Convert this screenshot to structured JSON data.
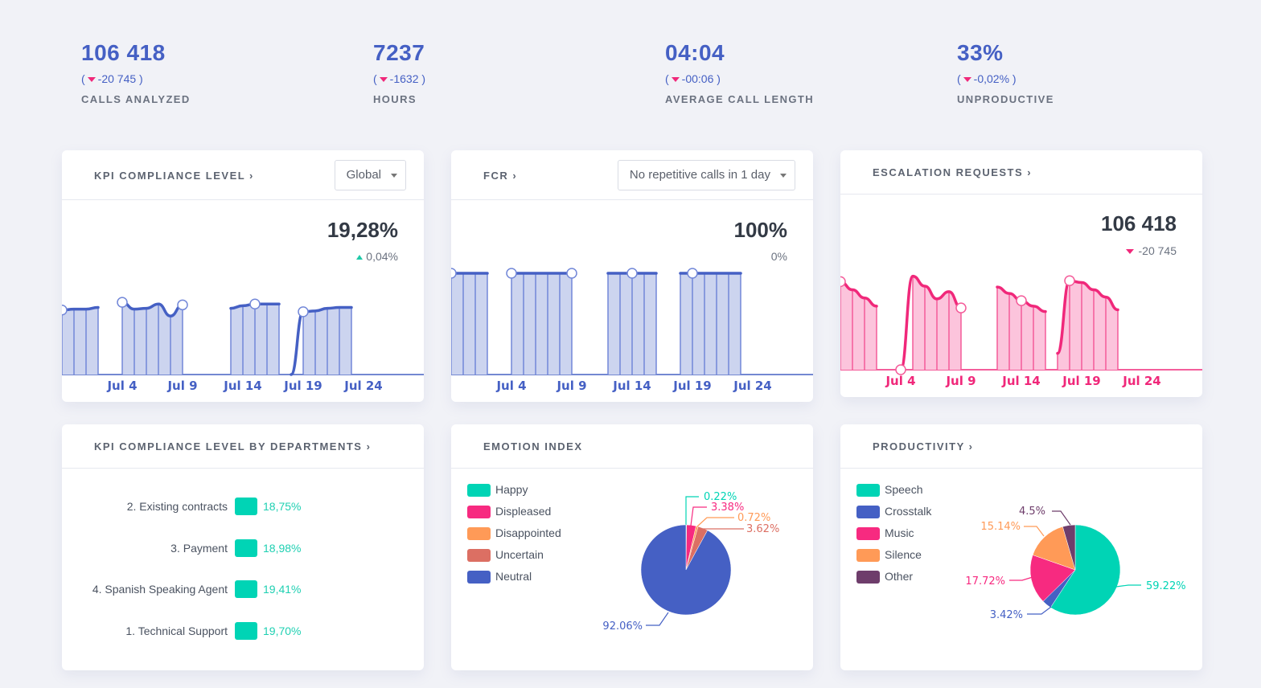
{
  "kpis": [
    {
      "value": "106 418",
      "delta_open": "(",
      "delta": "-20 745",
      "delta_close": ")",
      "trend": "down",
      "label": "CALLS ANALYZED"
    },
    {
      "value": "7237",
      "delta_open": "(",
      "delta": "-1632",
      "delta_close": ")",
      "trend": "down",
      "label": "HOURS"
    },
    {
      "value": "04:04",
      "delta_open": "(",
      "delta": "-00:06",
      "delta_close": ")",
      "trend": "down",
      "label": "AVERAGE CALL LENGTH"
    },
    {
      "value": "33%",
      "delta_open": "(",
      "delta": "-0,02%",
      "delta_close": ")",
      "trend": "down",
      "label": "UNPRODUCTIVE"
    }
  ],
  "cards": {
    "kpi_compliance": {
      "title": "KPI COMPLIANCE LEVEL ›",
      "select": "Global",
      "value": "19,28%",
      "delta": "0,04%",
      "trend": "up"
    },
    "fcr": {
      "title": "FCR ›",
      "select": "No repetitive calls in 1 day",
      "value": "100%",
      "delta": "0%",
      "trend": "none"
    },
    "escalation": {
      "title": "ESCALATION REQUESTS ›",
      "value": "106 418",
      "delta": "-20 745",
      "trend": "down"
    },
    "departments": {
      "title": "KPI COMPLIANCE LEVEL BY DEPARTMENTS ›"
    },
    "emotion": {
      "title": "EMOTION INDEX"
    },
    "productivity": {
      "title": "PRODUCTIVITY ›"
    }
  },
  "colors": {
    "accent_blue": "#4560c4",
    "pink": "#f0287a",
    "teal": "#00d4b5",
    "orange": "#ff9a57",
    "uncertain": "#dc6f63",
    "other": "#6e3d6b"
  },
  "chart_data": [
    {
      "id": "kpi_compliance",
      "type": "area",
      "title": "KPI COMPLIANCE LEVEL",
      "x_ticks": [
        "Jul 4",
        "Jul 9",
        "Jul 14",
        "Jul 19",
        "Jul 24"
      ],
      "x_range": [
        "Jun 29",
        "Jul 29"
      ],
      "ylim": [
        0,
        100
      ],
      "segments": [
        {
          "start_day": 0,
          "values": [
            75,
            76,
            76,
            78
          ],
          "markers": [
            0
          ]
        },
        {
          "start_day": 5,
          "values": [
            84,
            76,
            77,
            82,
            68,
            81
          ],
          "markers": [
            0,
            5
          ]
        },
        {
          "start_day": 14,
          "values": [
            77,
            80,
            82,
            82,
            82
          ],
          "markers": [
            2
          ]
        },
        {
          "start_day": 19,
          "values": [
            0,
            73,
            74,
            77,
            78,
            78
          ],
          "markers": [
            1
          ]
        }
      ]
    },
    {
      "id": "fcr",
      "type": "area",
      "title": "FCR",
      "x_ticks": [
        "Jul 4",
        "Jul 9",
        "Jul 14",
        "Jul 19",
        "Jul 24"
      ],
      "x_range": [
        "Jun 29",
        "Jul 29"
      ],
      "ylim": [
        0,
        100
      ],
      "segments": [
        {
          "start_day": 0,
          "values": [
            100,
            100,
            100,
            100
          ],
          "markers": [
            0
          ]
        },
        {
          "start_day": 5,
          "values": [
            100,
            100,
            100,
            100,
            100,
            100
          ],
          "markers": [
            0,
            5
          ]
        },
        {
          "start_day": 13,
          "values": [
            100,
            100,
            100,
            100,
            100
          ],
          "markers": [
            2
          ]
        },
        {
          "start_day": 19,
          "values": [
            100,
            100,
            100,
            100,
            100,
            100
          ],
          "markers": [
            1
          ]
        }
      ]
    },
    {
      "id": "escalation",
      "type": "area",
      "title": "ESCALATION REQUESTS",
      "x_ticks": [
        "Jul 4",
        "Jul 9",
        "Jul 14",
        "Jul 19",
        "Jul 24"
      ],
      "x_range": [
        "Jun 29",
        "Jul 29"
      ],
      "ylim": [
        0,
        100
      ],
      "segments": [
        {
          "start_day": 0,
          "values": [
            97,
            88,
            79,
            70
          ],
          "markers": [
            0
          ]
        },
        {
          "start_day": 5,
          "values": [
            0,
            103,
            92,
            78,
            86,
            68
          ],
          "markers": [
            0,
            5
          ]
        },
        {
          "start_day": 13,
          "values": [
            91,
            84,
            76,
            70,
            64
          ],
          "markers": [
            2
          ]
        },
        {
          "start_day": 18,
          "values": [
            18,
            98,
            96,
            88,
            80,
            66
          ],
          "markers": [
            1
          ]
        }
      ]
    },
    {
      "id": "departments",
      "type": "bar",
      "title": "KPI COMPLIANCE LEVEL BY DEPARTMENTS",
      "categories": [
        "2. Existing contracts",
        "3. Payment",
        "4. Spanish Speaking Agent",
        "1. Technical Support"
      ],
      "values": [
        18.75,
        18.98,
        19.41,
        19.7
      ],
      "labels": [
        "18,75%",
        "18,98%",
        "19,41%",
        "19,70%"
      ]
    },
    {
      "id": "emotion",
      "type": "pie",
      "title": "EMOTION INDEX",
      "legend": "left",
      "slices": [
        {
          "name": "Happy",
          "value": 0.22,
          "label": "0.22%",
          "color": "#00d4b5"
        },
        {
          "name": "Displeased",
          "value": 3.38,
          "label": "3.38%",
          "color": "#f72a80"
        },
        {
          "name": "Disappointed",
          "value": 0.72,
          "label": "0.72%",
          "color": "#ff9a57"
        },
        {
          "name": "Uncertain",
          "value": 3.62,
          "label": "3.62%",
          "color": "#dc6f63"
        },
        {
          "name": "Neutral",
          "value": 92.06,
          "label": "92.06%",
          "color": "#4560c4"
        }
      ]
    },
    {
      "id": "productivity",
      "type": "pie",
      "title": "PRODUCTIVITY",
      "legend": "left",
      "slices": [
        {
          "name": "Speech",
          "value": 59.22,
          "label": "59.22%",
          "color": "#00d4b5"
        },
        {
          "name": "Crosstalk",
          "value": 3.42,
          "label": "3.42%",
          "color": "#4560c4"
        },
        {
          "name": "Music",
          "value": 17.72,
          "label": "17.72%",
          "color": "#f72a80"
        },
        {
          "name": "Silence",
          "value": 15.14,
          "label": "15.14%",
          "color": "#ff9a57"
        },
        {
          "name": "Other",
          "value": 4.5,
          "label": "4.5%",
          "color": "#6e3d6b"
        }
      ]
    }
  ]
}
